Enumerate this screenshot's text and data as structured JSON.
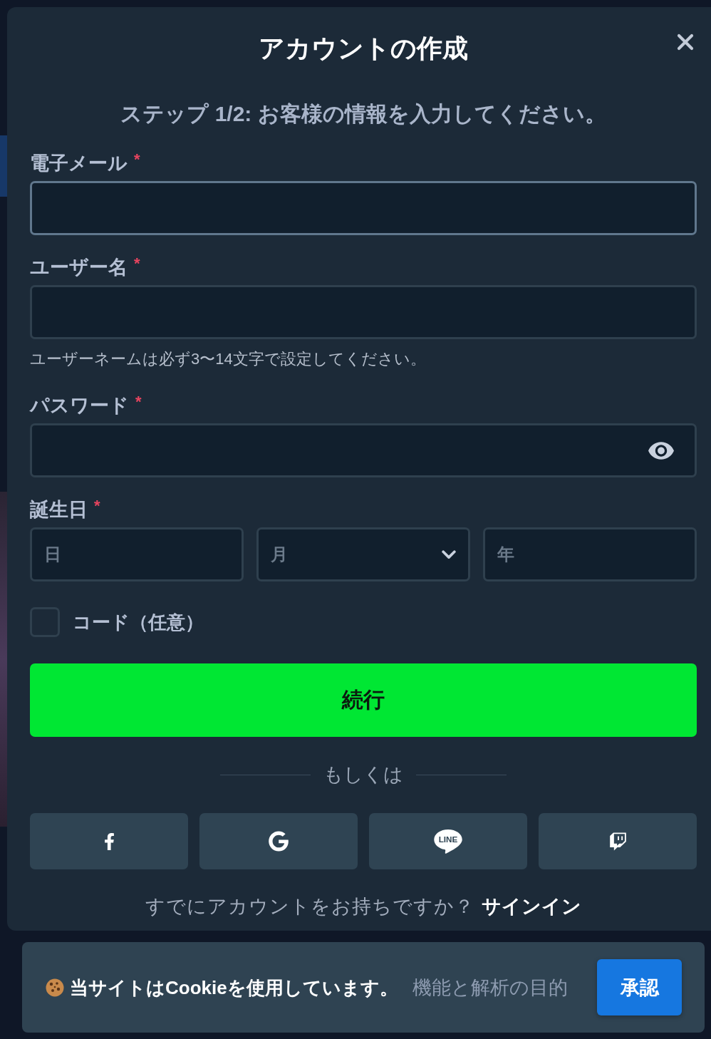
{
  "dialog": {
    "title": "アカウントの作成",
    "step_text": "ステップ 1/2: お客様の情報を入力してください。"
  },
  "fields": [
    {
      "kind": "text",
      "label": "電子メール",
      "required_mark": "*",
      "focused": true
    },
    {
      "kind": "text",
      "label": "ユーザー名",
      "required_mark": "*",
      "focused": false,
      "hint": "ユーザーネームは必ず3〜14文字で設定してください。"
    },
    {
      "kind": "password",
      "label": "パスワード",
      "required_mark": "*",
      "focused": false
    },
    {
      "kind": "date",
      "label": "誕生日",
      "required_mark": "*",
      "parts": [
        {
          "kind": "text",
          "placeholder": "日"
        },
        {
          "kind": "select",
          "placeholder": "月"
        },
        {
          "kind": "text",
          "placeholder": "年"
        }
      ]
    }
  ],
  "code_option": {
    "label": "コード（任意）",
    "checked": false
  },
  "continue_button": "続行",
  "divider_text": "もしくは",
  "social_buttons": [
    {
      "kind": "facebook"
    },
    {
      "kind": "google"
    },
    {
      "kind": "line",
      "logo_text": "LINE"
    },
    {
      "kind": "twitch"
    }
  ],
  "signin": {
    "prompt": "すでにアカウントをお持ちですか？",
    "link": "サインイン"
  },
  "cookie_banner": {
    "message": "当サイトはCookieを使用しています。",
    "detail": "機能と解析の目的",
    "accept_button": "承認"
  }
}
